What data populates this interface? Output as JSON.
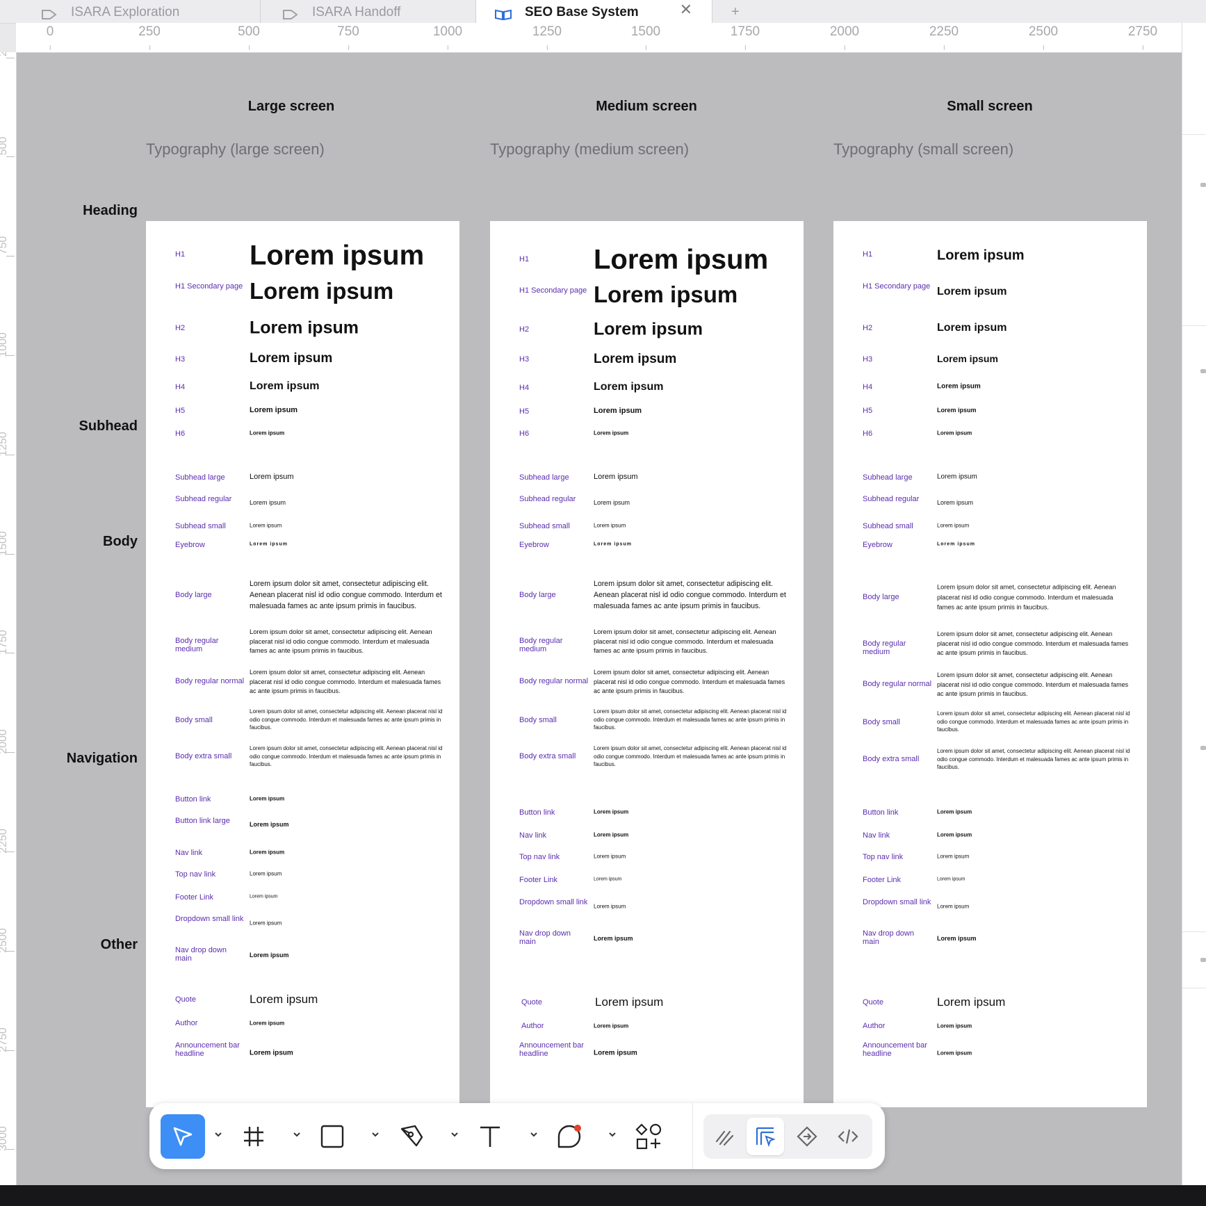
{
  "tabs": [
    {
      "label": "ISARA Exploration",
      "icon": "component-tag-icon",
      "active": false
    },
    {
      "label": "ISARA Handoff",
      "icon": "component-tag-icon",
      "active": false
    },
    {
      "label": "SEO Base System",
      "icon": "book-icon",
      "active": true
    }
  ],
  "ruler": {
    "x_ticks": [
      "0",
      "250",
      "500",
      "750",
      "1000",
      "1250",
      "1500",
      "1750",
      "2000",
      "2250",
      "2500",
      "2750"
    ],
    "y_ticks": [
      "250",
      "500",
      "750",
      "1000",
      "1250",
      "1500",
      "1750",
      "2000",
      "2250",
      "2500",
      "2750",
      "3000"
    ]
  },
  "categories": {
    "heading": "Heading",
    "subhead": "Subhead",
    "body": "Body",
    "navigation": "Navigation",
    "other": "Other"
  },
  "sample_text": "Lorem ipsum",
  "body_text": "Lorem ipsum dolor sit amet, consectetur adipiscing elit. Aenean placerat nisl id odio congue commodo. Interdum et malesuada fames ac ante ipsum primis in faucibus.",
  "screens": [
    {
      "title": "Large screen",
      "frame_label": "Typography (large screen)",
      "heading": [
        {
          "label": "H1"
        },
        {
          "label": "H1 Secondary page"
        },
        {
          "label": "H2"
        },
        {
          "label": "H3"
        },
        {
          "label": "H4"
        },
        {
          "label": "H5"
        },
        {
          "label": "H6"
        }
      ],
      "subhead": [
        {
          "label": "Subhead large"
        },
        {
          "label": "Subhead regular"
        },
        {
          "label": "Subhead small"
        },
        {
          "label": "Eyebrow"
        }
      ],
      "body": [
        {
          "label": "Body large"
        },
        {
          "label": "Body regular medium"
        },
        {
          "label": "Body regular normal"
        },
        {
          "label": "Body small"
        },
        {
          "label": "Body extra small"
        }
      ],
      "navigation": [
        {
          "label": "Button link"
        },
        {
          "label": "Button link large"
        },
        {
          "label": "Nav link"
        },
        {
          "label": "Top nav link"
        },
        {
          "label": "Footer Link"
        },
        {
          "label": "Dropdown small link"
        },
        {
          "label": "Nav drop down main"
        }
      ],
      "other": [
        {
          "label": "Quote"
        },
        {
          "label": "Author"
        },
        {
          "label": "Announcement bar headline"
        }
      ]
    },
    {
      "title": "Medium screen",
      "frame_label": "Typography (medium screen)",
      "heading": [
        {
          "label": "H1"
        },
        {
          "label": "H1 Secondary page"
        },
        {
          "label": "H2"
        },
        {
          "label": "H3"
        },
        {
          "label": "H4"
        },
        {
          "label": "H5"
        },
        {
          "label": "H6"
        }
      ],
      "subhead": [
        {
          "label": "Subhead large"
        },
        {
          "label": "Subhead regular"
        },
        {
          "label": "Subhead small"
        },
        {
          "label": "Eyebrow"
        }
      ],
      "body": [
        {
          "label": "Body large"
        },
        {
          "label": "Body regular medium"
        },
        {
          "label": "Body regular normal"
        },
        {
          "label": "Body small"
        },
        {
          "label": "Body extra small"
        }
      ],
      "navigation": [
        {
          "label": "Button link"
        },
        {
          "label": "Nav link"
        },
        {
          "label": "Top nav link"
        },
        {
          "label": "Footer Link"
        },
        {
          "label": "Dropdown small link"
        },
        {
          "label": "Nav drop down main"
        }
      ],
      "other": [
        {
          "label": "Quote"
        },
        {
          "label": "Author"
        },
        {
          "label": "Announcement bar headline"
        }
      ]
    },
    {
      "title": "Small screen",
      "frame_label": "Typography (small screen)",
      "heading": [
        {
          "label": "H1"
        },
        {
          "label": "H1 Secondary page"
        },
        {
          "label": "H2"
        },
        {
          "label": "H3"
        },
        {
          "label": "H4"
        },
        {
          "label": "H5"
        },
        {
          "label": "H6"
        }
      ],
      "subhead": [
        {
          "label": "Subhead large"
        },
        {
          "label": "Subhead regular"
        },
        {
          "label": "Subhead small"
        },
        {
          "label": "Eyebrow"
        }
      ],
      "body": [
        {
          "label": "Body large"
        },
        {
          "label": "Body regular medium"
        },
        {
          "label": "Body regular normal"
        },
        {
          "label": "Body small"
        },
        {
          "label": "Body extra small"
        }
      ],
      "navigation": [
        {
          "label": "Button link"
        },
        {
          "label": "Nav link"
        },
        {
          "label": "Top nav link"
        },
        {
          "label": "Footer Link"
        },
        {
          "label": "Dropdown small link"
        },
        {
          "label": "Nav drop down main"
        }
      ],
      "other": [
        {
          "label": "Quote"
        },
        {
          "label": "Author"
        },
        {
          "label": "Announcement bar headline"
        }
      ]
    }
  ],
  "toolbar": {
    "tools": [
      "move-tool-icon",
      "frame-tool-icon",
      "rectangle-tool-icon",
      "pen-tool-icon",
      "text-tool-icon",
      "comment-tool-icon",
      "actions-icon"
    ],
    "modes": [
      "draw-mode-icon",
      "design-mode-icon",
      "prototype-mode-icon",
      "dev-mode-icon"
    ],
    "accent_color": "#3d8ef5",
    "notification_color": "#e2412b"
  },
  "colors": {
    "canvas": "#bcbcbf",
    "style_label": "#5b2dae"
  }
}
